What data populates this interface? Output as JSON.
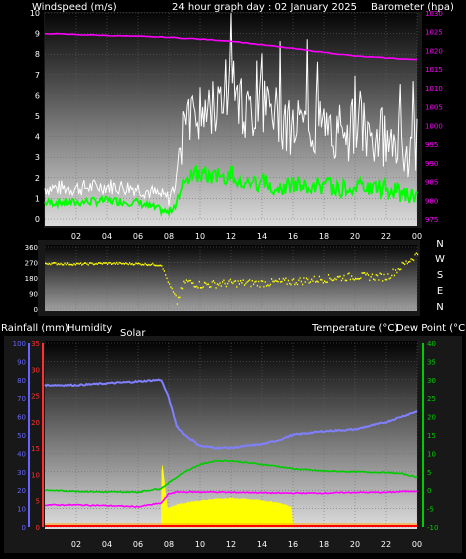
{
  "header": {
    "windspeed_label": "Windspeed (m/s)",
    "title": "24 hour graph day : 02 January 2025",
    "barometer_label": "Barometer (hpa)"
  },
  "labels": {
    "rainfall": "Rainfall (mm)",
    "humidity": "Humidity",
    "solar": "Solar",
    "temperature": "Temperature (°C)",
    "dew_point": "Dew Point (°C)"
  },
  "compass": [
    "N",
    "W",
    "S",
    "E",
    "N"
  ],
  "colors": {
    "gust": "#ffffff",
    "wind": "#00ff00",
    "barometer": "#ff00ff",
    "direction": "#ffff00",
    "humidity": "#8080ff",
    "temperature": "#00cc00",
    "dewpoint": "#ff00ff",
    "solar": "#ffff00",
    "rain": "#ff0000",
    "left_axis_rain": "#ff3030",
    "left_axis_hum": "#6666ff",
    "right_axis_baro": "#ff00ff",
    "right_axis_temp": "#00cc00"
  },
  "chart_data": [
    {
      "type": "line",
      "name": "wind-barometer",
      "x_ticks": [
        "02",
        "04",
        "06",
        "08",
        "10",
        "12",
        "14",
        "16",
        "18",
        "20",
        "22",
        "00"
      ],
      "hours": [
        0,
        2,
        4,
        6,
        8,
        8.5,
        9,
        10,
        11,
        12,
        13,
        14,
        15,
        16,
        17,
        18,
        19,
        20,
        21,
        22,
        23,
        24
      ],
      "gust": [
        1.5,
        1.5,
        1.6,
        1.5,
        1.0,
        1.8,
        4.5,
        5.0,
        5.5,
        6.5,
        5.0,
        5.5,
        5.0,
        4.5,
        4.5,
        4.5,
        4.0,
        4.5,
        4.0,
        4.0,
        3.5,
        3.5
      ],
      "wind": [
        0.8,
        0.8,
        0.9,
        0.8,
        0.3,
        0.8,
        2.0,
        2.2,
        2.0,
        2.2,
        1.8,
        1.8,
        1.6,
        1.6,
        1.6,
        1.6,
        1.5,
        1.6,
        1.5,
        1.5,
        1.2,
        1.0
      ],
      "barometer_hours": [
        0,
        4,
        8,
        10,
        12,
        14,
        16,
        18,
        20,
        22,
        24
      ],
      "barometer": [
        1024.5,
        1024.0,
        1023.5,
        1023.0,
        1022.5,
        1021.5,
        1020.5,
        1019.5,
        1018.5,
        1018.0,
        1017.5
      ],
      "y_ticks": [
        "0",
        "1",
        "2",
        "3",
        "4",
        "5",
        "6",
        "7",
        "8",
        "9",
        "10"
      ],
      "y_right_ticks": [
        "975",
        "980",
        "985",
        "990",
        "995",
        "1000",
        "1005",
        "1010",
        "1015",
        "1020",
        "1025",
        "1030"
      ],
      "ylim": [
        0,
        10
      ],
      "y2lim": [
        975,
        1030
      ]
    },
    {
      "type": "scatter",
      "name": "wind-direction",
      "y_ticks": [
        "0",
        "90",
        "180",
        "270",
        "360"
      ],
      "hours": [
        0,
        2,
        4,
        6,
        7.5,
        8,
        8.5,
        9,
        10,
        12,
        14,
        16,
        18,
        20,
        22,
        23,
        24
      ],
      "direction": [
        265,
        260,
        265,
        262,
        255,
        140,
        40,
        160,
        140,
        150,
        150,
        160,
        175,
        190,
        185,
        250,
        320
      ],
      "ylim": [
        0,
        360
      ]
    },
    {
      "type": "line",
      "name": "rain-humidity-temperature-solar",
      "x_ticks": [
        "02",
        "04",
        "06",
        "08",
        "10",
        "12",
        "14",
        "16",
        "18",
        "20",
        "22",
        "00"
      ],
      "hours": [
        0,
        2,
        4,
        6,
        7.5,
        8,
        8.5,
        9,
        10,
        11,
        12,
        13,
        14,
        15,
        16,
        17,
        18,
        20,
        22,
        23,
        24
      ],
      "humidity": [
        77,
        77,
        78,
        79,
        80,
        70,
        55,
        50,
        44,
        43,
        43,
        44,
        45,
        47,
        50,
        51,
        52,
        53,
        57,
        60,
        63
      ],
      "temperature": [
        0,
        -0.3,
        -0.5,
        -0.5,
        0.5,
        2,
        3.5,
        5,
        7,
        8,
        8,
        7.5,
        7,
        6.5,
        5.8,
        5.5,
        5.2,
        5,
        4.8,
        4.5,
        3.5
      ],
      "dewpoint": [
        -4,
        -4,
        -4.2,
        -4.5,
        -3.5,
        -1,
        -0.5,
        -0.5,
        -0.5,
        -0.5,
        -0.6,
        -0.6,
        -0.7,
        -0.8,
        -0.8,
        -0.8,
        -0.8,
        -0.6,
        -0.6,
        -0.4,
        -0.2
      ],
      "solar_hours": [
        7.5,
        7.55,
        7.9,
        8.5,
        9,
        10,
        11,
        12,
        13,
        14,
        15,
        15.5,
        15.9,
        16
      ],
      "solar": [
        0,
        18,
        5,
        6,
        6.5,
        7.2,
        7.6,
        7.8,
        7.6,
        7.2,
        6.6,
        6.0,
        5.4,
        0
      ],
      "rain": 0,
      "y_left_ticks": [
        "0",
        "10",
        "20",
        "30",
        "40",
        "50",
        "60",
        "70",
        "80",
        "90",
        "100"
      ],
      "y_rain_ticks": [
        "0",
        "5",
        "10",
        "15",
        "20",
        "25",
        "30",
        "35"
      ],
      "y_right_ticks": [
        "-10",
        "-5",
        "0",
        "5",
        "10",
        "15",
        "20",
        "25",
        "30",
        "35",
        "40"
      ],
      "ylim": [
        0,
        100
      ],
      "y2lim": [
        -10,
        40
      ]
    }
  ]
}
